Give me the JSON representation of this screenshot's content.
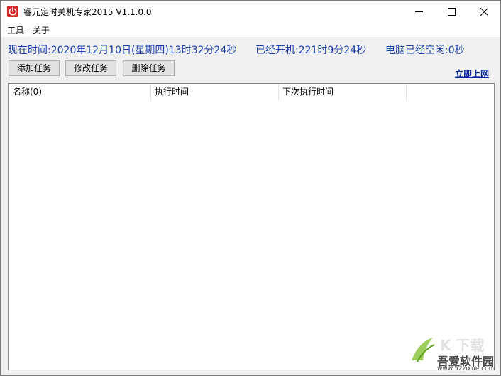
{
  "window": {
    "title": "睿元定时关机专家2015 V1.1.0.0",
    "icon": "power-icon",
    "accent_color": "#d62b2b"
  },
  "menu": {
    "items": [
      {
        "label": "工具"
      },
      {
        "label": "关于"
      }
    ]
  },
  "status": {
    "current_time": "现在时间:2020年12月10日(星期四)13时32分24秒",
    "uptime": "已经开机:221时9分24秒",
    "idle": "电脑已经空闲:0秒",
    "text_color": "#1d3fa8"
  },
  "toolbar": {
    "add_label": "添加任务",
    "edit_label": "修改任务",
    "delete_label": "删除任务",
    "online_link": "立即上网"
  },
  "task_list": {
    "columns": [
      "名称(0)",
      "执行时间",
      "下次执行时间"
    ],
    "rows": []
  },
  "watermark": {
    "brand": "吾爱软件园",
    "url": "www.52zixue.com"
  }
}
